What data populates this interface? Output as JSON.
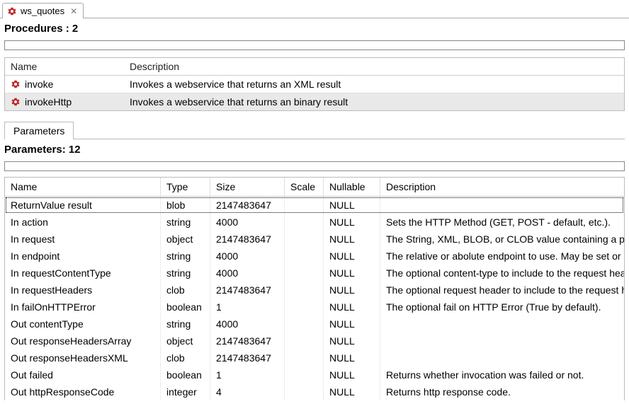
{
  "tab": {
    "label": "ws_quotes"
  },
  "procedures": {
    "title": "Procedures : 2",
    "columns": {
      "name": "Name",
      "desc": "Description"
    },
    "rows": [
      {
        "name": "invoke",
        "desc": "Invokes a webservice that returns an XML result",
        "selected": false
      },
      {
        "name": "invokeHttp",
        "desc": "Invokes a webservice that returns an binary result",
        "selected": true
      }
    ]
  },
  "paramsTab": {
    "label": "Parameters"
  },
  "parameters": {
    "title": "Parameters: 12",
    "columns": {
      "name": "Name",
      "type": "Type",
      "size": "Size",
      "scale": "Scale",
      "nullable": "Nullable",
      "desc": "Description"
    },
    "rows": [
      {
        "name": "ReturnValue result",
        "type": "blob",
        "size": "2147483647",
        "scale": "",
        "nullable": "NULL",
        "desc": ""
      },
      {
        "name": "In action",
        "type": "string",
        "size": "4000",
        "scale": "",
        "nullable": "NULL",
        "desc": "Sets the HTTP Method (GET, POST - default, etc.)."
      },
      {
        "name": "In request",
        "type": "object",
        "size": "2147483647",
        "scale": "",
        "nullable": "NULL",
        "desc": "The String, XML, BLOB, or CLOB value containing a payload"
      },
      {
        "name": "In endpoint",
        "type": "string",
        "size": "4000",
        "scale": "",
        "nullable": "NULL",
        "desc": "The relative or abolute endpoint to use.  May be set or allo"
      },
      {
        "name": "In requestContentType",
        "type": "string",
        "size": "4000",
        "scale": "",
        "nullable": "NULL",
        "desc": "The optional content-type to include to the request heade"
      },
      {
        "name": "In requestHeaders",
        "type": "clob",
        "size": "2147483647",
        "scale": "",
        "nullable": "NULL",
        "desc": "The optional request header to include to the request head"
      },
      {
        "name": "In failOnHTTPError",
        "type": "boolean",
        "size": "1",
        "scale": "",
        "nullable": "NULL",
        "desc": "The optional fail on HTTP Error (True by default)."
      },
      {
        "name": "Out contentType",
        "type": "string",
        "size": "4000",
        "scale": "",
        "nullable": "NULL",
        "desc": ""
      },
      {
        "name": "Out responseHeadersArray",
        "type": "object",
        "size": "2147483647",
        "scale": "",
        "nullable": "NULL",
        "desc": ""
      },
      {
        "name": "Out responseHeadersXML",
        "type": "clob",
        "size": "2147483647",
        "scale": "",
        "nullable": "NULL",
        "desc": ""
      },
      {
        "name": "Out failed",
        "type": "boolean",
        "size": "1",
        "scale": "",
        "nullable": "NULL",
        "desc": "Returns whether invocation was failed or not."
      },
      {
        "name": "Out httpResponseCode",
        "type": "integer",
        "size": "4",
        "scale": "",
        "nullable": "NULL",
        "desc": "Returns http response code."
      }
    ]
  }
}
